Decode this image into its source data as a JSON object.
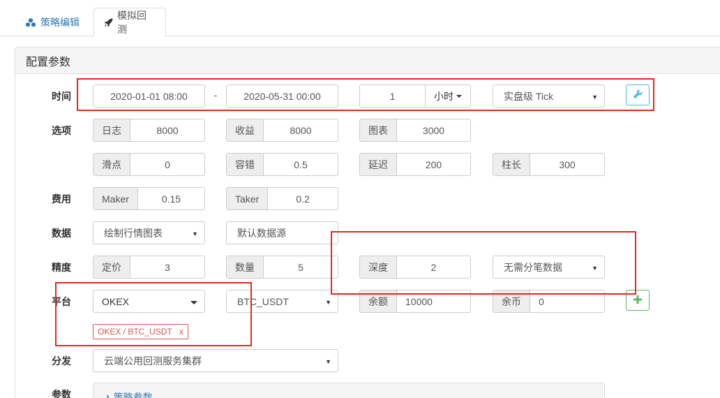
{
  "tabs": [
    {
      "label": "策略编辑",
      "icon": "cubes-icon"
    },
    {
      "label": "模拟回测",
      "icon": "rocket-icon"
    }
  ],
  "panel": {
    "title": "配置参数"
  },
  "labels": {
    "time": "时间",
    "options": "选项",
    "fees": "费用",
    "data": "数据",
    "precision": "精度",
    "platform": "平台",
    "dispatch": "分发",
    "params": "参数"
  },
  "time": {
    "start": "2020-01-01 08:00",
    "separator": "-",
    "end": "2020-05-31 00:00",
    "period_value": "1",
    "period_unit": "小时",
    "tick_mode": "实盘级 Tick"
  },
  "options": {
    "log": {
      "label": "日志",
      "value": "8000"
    },
    "profit": {
      "label": "收益",
      "value": "8000"
    },
    "chart": {
      "label": "图表",
      "value": "3000"
    },
    "slippage": {
      "label": "滑点",
      "value": "0"
    },
    "fault_tolerance": {
      "label": "容错",
      "value": "0.5"
    },
    "delay": {
      "label": "延迟",
      "value": "200"
    },
    "bar_length": {
      "label": "柱长",
      "value": "300"
    }
  },
  "fees": {
    "maker": {
      "label": "Maker",
      "value": "0.15"
    },
    "taker": {
      "label": "Taker",
      "value": "0.2"
    }
  },
  "data": {
    "chart_mode": "绘制行情图表",
    "source": "默认数据源"
  },
  "precision": {
    "price": {
      "label": "定价",
      "value": "3"
    },
    "quantity": {
      "label": "数量",
      "value": "5"
    },
    "depth": {
      "label": "深度",
      "value": "2"
    },
    "trades": "无需分笔数据"
  },
  "platform": {
    "exchange": "OKEX",
    "pair": "BTC_USDT",
    "balance": {
      "label": "余额",
      "value": "10000"
    },
    "coins": {
      "label": "余币",
      "value": "0"
    },
    "tag": "OKEX / BTC_USDT",
    "tag_close": "x"
  },
  "dispatch": {
    "cluster": "云端公用回测服务集群"
  },
  "params": {
    "section": "策略参数"
  },
  "colors": {
    "accent": "#337ab7",
    "annotation": "#e5261f",
    "info": "#5bc0de",
    "success": "#5cb85c",
    "danger": "#d9534f"
  }
}
